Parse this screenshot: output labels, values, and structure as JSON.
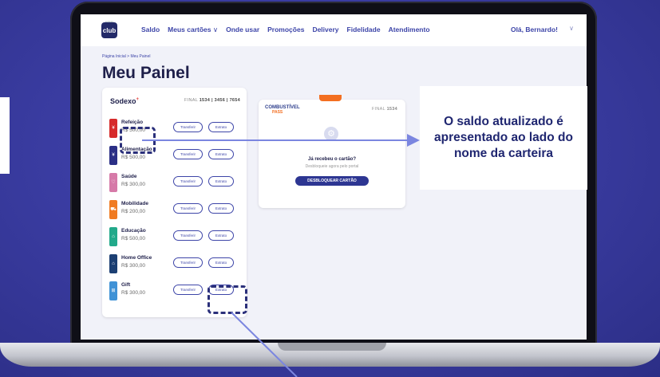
{
  "nav": {
    "logo_top": "sodexo",
    "logo": "club",
    "items": [
      "Saldo",
      "Meus cartões",
      "Onde usar",
      "Promoções",
      "Delivery",
      "Fidelidade",
      "Atendimento"
    ],
    "user": "Olá, Bernardo!"
  },
  "breadcrumb": "Página Inicial > Meu Painel",
  "page_title": "Meu Painel",
  "wallet": {
    "brand": "Sodexo",
    "brand_mark": "+",
    "final_label": "FINAL",
    "final_numbers": "1534 | 3456 | 7654",
    "transfer_label": "Transferir",
    "statement_label": "Extrato",
    "items": [
      {
        "name": "Refeição",
        "value": "R$ 500,00",
        "color": "#d62a2a",
        "icon": "fork-knife-icon"
      },
      {
        "name": "Alimentação",
        "value": "R$ 500,00",
        "color": "#2b2f86",
        "icon": "cutlery-icon"
      },
      {
        "name": "Saúde",
        "value": "R$ 300,00",
        "color": "#d67aa8",
        "icon": "heart-icon"
      },
      {
        "name": "Mobilidade",
        "value": "R$ 200,00",
        "color": "#f07b22",
        "icon": "car-icon"
      },
      {
        "name": "Educação",
        "value": "R$ 500,00",
        "color": "#22a98a",
        "icon": "graduation-icon"
      },
      {
        "name": "Home Office",
        "value": "R$ 300,00",
        "color": "#1c3f73",
        "icon": "home-icon"
      },
      {
        "name": "Gift",
        "value": "R$ 300,00",
        "color": "#3f92d6",
        "icon": "gift-icon"
      }
    ]
  },
  "fuel_card": {
    "brand_top": "COMBUSTÍVEL",
    "brand_bottom": "PASS",
    "final_label": "FINAL",
    "final_number": "1534",
    "question": "Já recebeu o cartão?",
    "hint": "Desbloqueie agora pelo portal",
    "button": "DESBLOQUEAR CARTÃO",
    "accent": "#f36f21"
  },
  "callout": {
    "text": "O saldo atualizado é apresentado ao lado do nome da carteira"
  },
  "colors": {
    "background": "#3b3da3",
    "brand_blue": "#3d45a8",
    "arrow": "#7b86e0"
  }
}
